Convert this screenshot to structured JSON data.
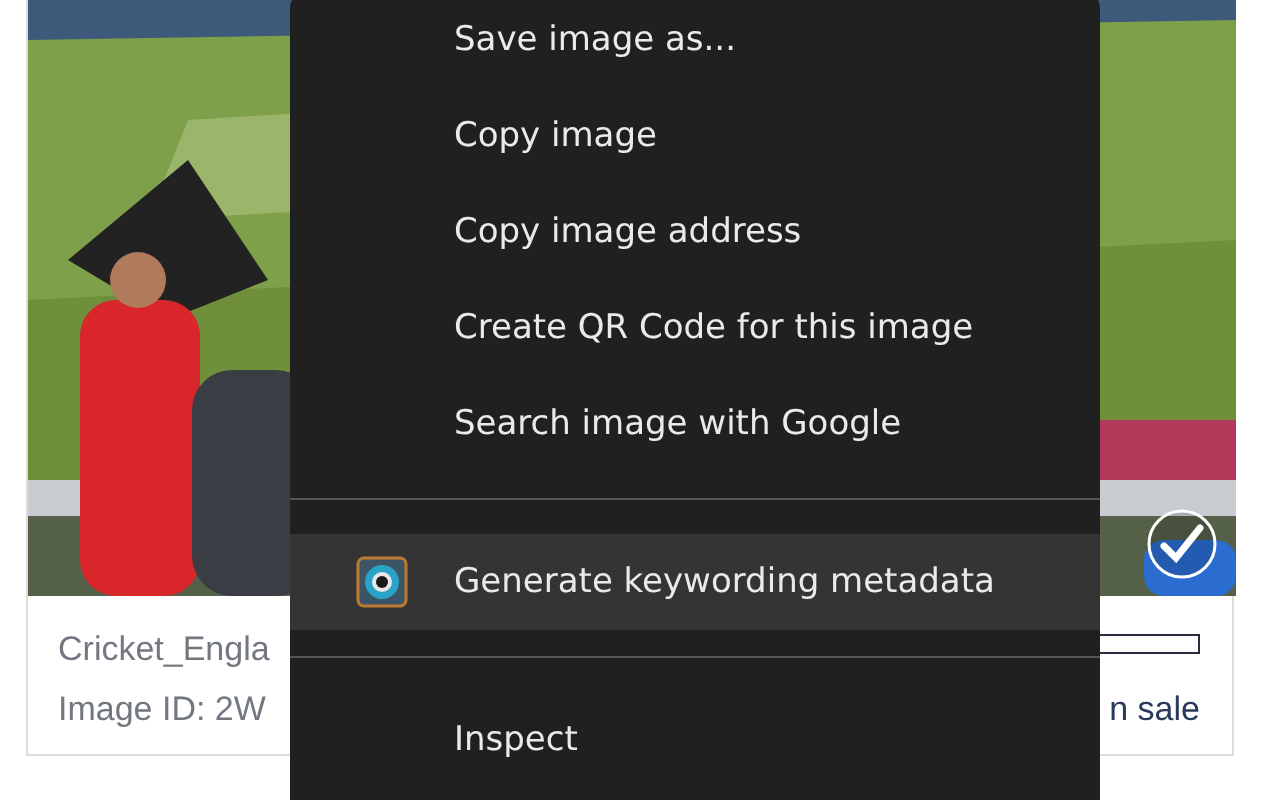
{
  "card": {
    "selected": true,
    "title": "Cricket_Engla",
    "image_id": "Image ID: 2W",
    "status": "n sale"
  },
  "context_menu": {
    "items": [
      {
        "kind": "item",
        "label": "Save image as...",
        "selected": false
      },
      {
        "kind": "item",
        "label": "Copy image",
        "selected": false
      },
      {
        "kind": "item",
        "label": "Copy image address",
        "selected": false
      },
      {
        "kind": "item",
        "label": "Create QR Code for this image",
        "selected": false
      },
      {
        "kind": "item",
        "label": "Search image with Google",
        "selected": false
      },
      {
        "kind": "separator"
      },
      {
        "kind": "extension",
        "label": "Generate keywording metadata",
        "selected": true
      },
      {
        "kind": "separator"
      },
      {
        "kind": "item",
        "label": "Inspect",
        "selected": false
      }
    ]
  }
}
